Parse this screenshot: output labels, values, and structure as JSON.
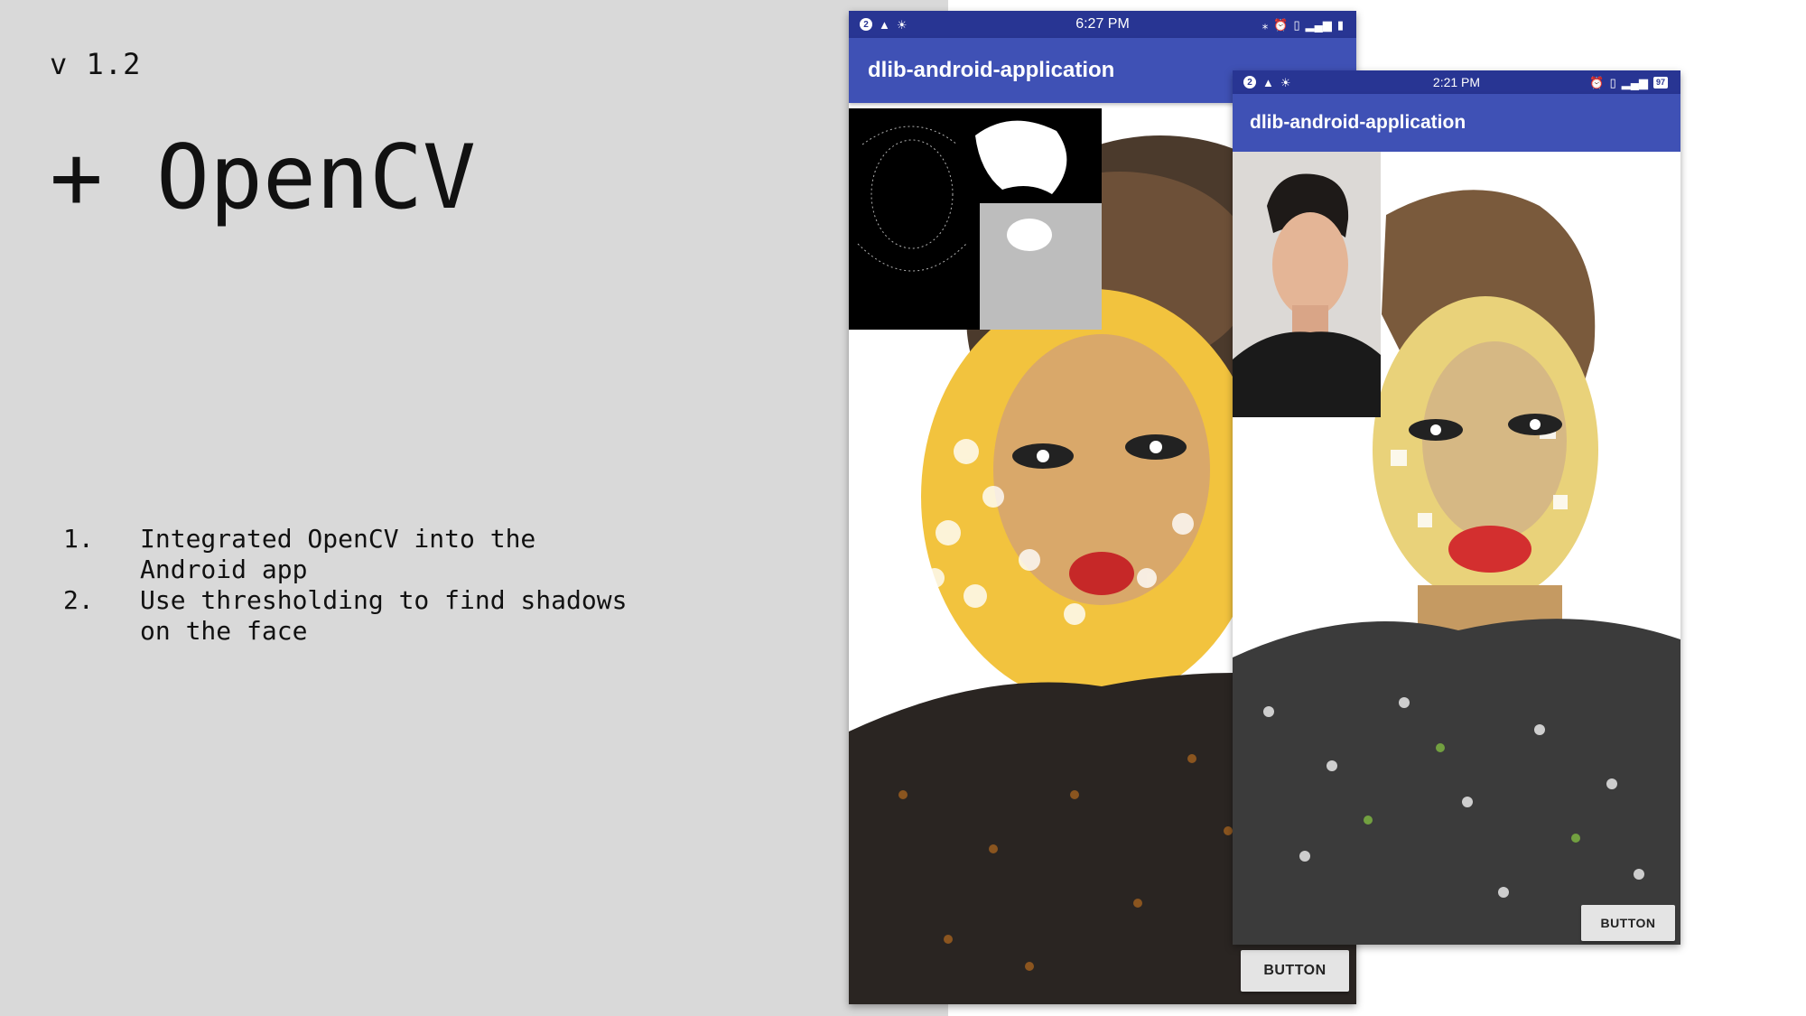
{
  "slide": {
    "version": "v 1.2",
    "title": "+ OpenCV",
    "steps": [
      {
        "num": "1.",
        "text": "Integrated OpenCV into the Android app"
      },
      {
        "num": "2.",
        "text": "Use thresholding to find shadows on the face"
      }
    ]
  },
  "phone_back": {
    "status_time": "6:27 PM",
    "notification_count": "2",
    "app_title": "dlib-android-application",
    "button_label": "BUTTON"
  },
  "phone_front": {
    "status_time": "2:21 PM",
    "notification_count": "2",
    "battery": "97",
    "app_title": "dlib-android-application",
    "button_label": "BUTTON"
  },
  "colors": {
    "status_bar": "#283593",
    "app_bar": "#3f51b5",
    "slide_background": "#d9d9d9"
  }
}
